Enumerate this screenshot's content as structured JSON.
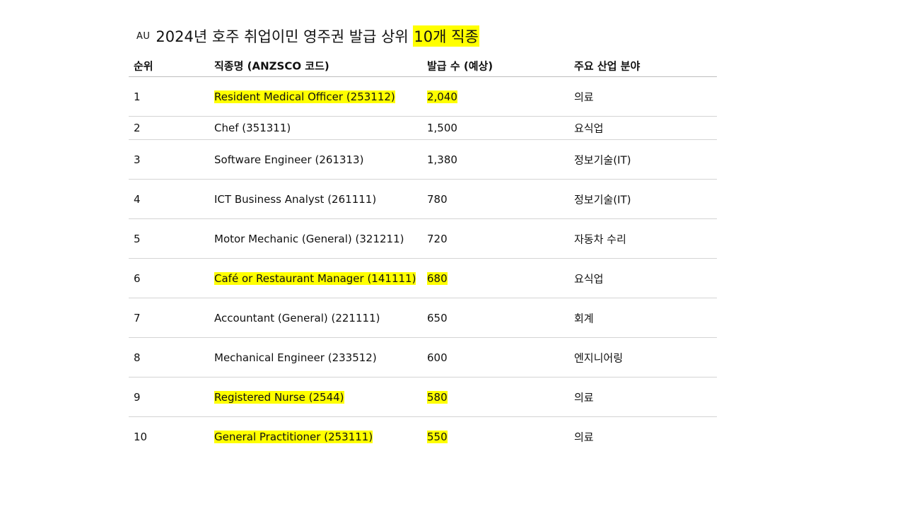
{
  "title": {
    "flag": "AU",
    "text": "2024년 호주 취업이민 영주권 발급 상위",
    "highlight": "10개 직종"
  },
  "table": {
    "headers": [
      "순위",
      "직종명 (ANZSCO 코드)",
      "발급 수 (예상)",
      "주요 산업 분야"
    ],
    "highlight_color": "#ffff00",
    "rows": [
      {
        "rank": "1",
        "occupation": "Resident Medical Officer (253112)",
        "count": "2,040",
        "industry": "의료",
        "highlighted": true
      },
      {
        "rank": "2",
        "occupation": "Chef (351311)",
        "count": "1,500",
        "industry": "요식업",
        "highlighted": false
      },
      {
        "rank": "3",
        "occupation": "Software Engineer (261313)",
        "count": "1,380",
        "industry": "정보기술(IT)",
        "highlighted": false
      },
      {
        "rank": "4",
        "occupation": "ICT Business Analyst (261111)",
        "count": "780",
        "industry": "정보기술(IT)",
        "highlighted": false
      },
      {
        "rank": "5",
        "occupation": "Motor Mechanic (General) (321211)",
        "count": "720",
        "industry": "자동차 수리",
        "highlighted": false
      },
      {
        "rank": "6",
        "occupation": "Café or Restaurant Manager (141111)",
        "count": "680",
        "industry": "요식업",
        "highlighted": true
      },
      {
        "rank": "7",
        "occupation": "Accountant (General) (221111)",
        "count": "650",
        "industry": "회계",
        "highlighted": false
      },
      {
        "rank": "8",
        "occupation": "Mechanical Engineer (233512)",
        "count": "600",
        "industry": "엔지니어링",
        "highlighted": false
      },
      {
        "rank": "9",
        "occupation": "Registered Nurse (2544)",
        "count": "580",
        "industry": "의료",
        "highlighted": true
      },
      {
        "rank": "10",
        "occupation": "General Practitioner (253111)",
        "count": "550",
        "industry": "의료",
        "highlighted": true
      }
    ]
  }
}
